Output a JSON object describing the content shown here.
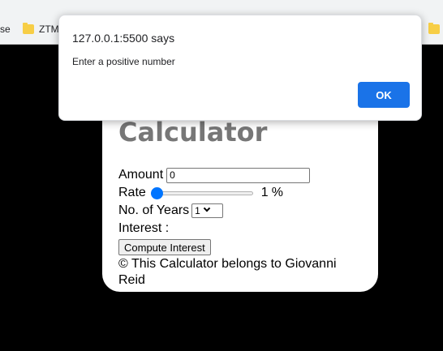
{
  "bookmarks": {
    "left_partial": "se",
    "ztm_partial": "ZTM"
  },
  "card": {
    "title": "Calculator",
    "amount_label": "Amount",
    "amount_value": "0",
    "rate_label": "Rate",
    "rate_value": "1",
    "rate_unit": "%",
    "rate_level_fraction": 0.0,
    "years_label": "No. of Years",
    "years_selected": "1",
    "interest_label": "Interest :",
    "compute_button": "Compute Interest",
    "footer": "© This Calculator belongs to Giovanni Reid"
  },
  "dialog": {
    "title": "127.0.0.1:5500 says",
    "message": "Enter a positive number",
    "ok_label": "OK"
  },
  "colors": {
    "accent": "#1a73e8",
    "slider": "#0075ff",
    "title": "#777777"
  }
}
